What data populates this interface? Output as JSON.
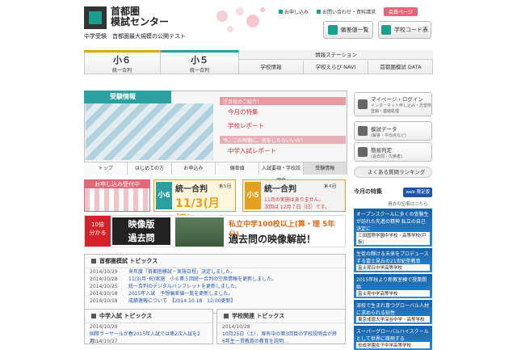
{
  "header": {
    "logo_line1": "首都圏",
    "logo_line2": "模試センター",
    "tagline": "中学受験　首都圏最大規模の公開テスト",
    "links": [
      "お申し込み",
      "お問い合わせ・資料請求"
    ],
    "member": "会員ページ",
    "btn_score": "偏差値一覧",
    "btn_school_code": "学校コード表"
  },
  "nav": {
    "grade6": {
      "label": "小６",
      "sub": "統一合判"
    },
    "grade5": {
      "label": "小５",
      "sub": "統一合判"
    },
    "info_title": "情報ステーション",
    "info_links": [
      "学校情報",
      "学校えらび NAVI",
      "首都圏模試 DATA"
    ]
  },
  "juken": {
    "title": "受験情報",
    "promo_head1": "注目校のご紹介！",
    "promo_links1": [
      "今月の特集",
      "学校レポート"
    ],
    "promo_head2": "今、この時期に、何をしたらいいの？",
    "promo_links2": [
      "中学入試レポート"
    ],
    "tabs": [
      "トップ",
      "はじめての方",
      "お申込み",
      "偏差値",
      "入試要項・学校説明会",
      "受験情報"
    ]
  },
  "banners": {
    "apply": "お申し込み受付中",
    "g6_badge": "小6",
    "g6_title": "統一合判",
    "g6_round": "第５回",
    "g6_date": "11/3(月祝)",
    "g5_badge": "小5",
    "g5_title": "統一合判",
    "g5_round": "第４回",
    "g5_note1": "11月の実施はありません。",
    "g5_note2": "次回は 12月７日（日）です。",
    "video_badge1": "10倍",
    "video_badge2": "分かる",
    "video_title1": "映像版",
    "video_title2": "過去問",
    "video_text1": "私立中学100校以上(算・理 5年分)",
    "video_text2": "過去問の映像解説！"
  },
  "topics_main": {
    "title": "首都圏模試 トピックス",
    "rows": [
      {
        "date": "2014/10/29",
        "msg": "来年度「首都圏模試・実施日程」決定しました。"
      },
      {
        "date": "2014/10/28",
        "msg": "11/3(月･祝)実施　小６第５回統一合判の空席情報を更新しました。"
      },
      {
        "date": "2014/10/25",
        "msg": "統一合判のデジタルパンフレットを更新しました。"
      },
      {
        "date": "2014/10/18",
        "msg": "2015年入試　予想偏差値一覧を更新しました。"
      },
      {
        "date": "2014/10/18",
        "msg": "成績速報について　【2014.10.18　12:00更新】"
      }
    ]
  },
  "topics_ju": {
    "title": "中学入試 トピックス",
    "rows": [
      {
        "date": "2014/10/29",
        "msg": "国際ラーサールが春2015年入試では第2次入試を2月…"
      },
      {
        "date": "2014/10/27",
        "msg": ""
      }
    ]
  },
  "topics_sc": {
    "title": "学校関連 トピックス",
    "rows": [
      {
        "date": "2014/10/28",
        "msg": "10月25日（土）、扉有中の第3回目の学校説明会が終"
      },
      {
        "date": "",
        "msg": "6年生一貫教育の教育を説明…"
      }
    ]
  },
  "right": {
    "mypage": "マイページ・ログイン",
    "mypage_sub": "インターネット申し込み・志望校登録・連絡処理",
    "data": "模試データ",
    "data_sub": "(解答・平均点など)",
    "kan": "簡易判定",
    "kan_sub": "(過去問・欠席者)",
    "faq": "よくある質問ランキング",
    "today": "今月の特集",
    "web": "web 限定版",
    "past": "過去の記事はこちら"
  },
  "ads": [
    {
      "t": "オープンスクールに多くの受験生が訪れた先進の精神 私立の自己決定に",
      "n": "三田国際学園中学校・高等学校(戸板)"
    },
    {
      "t": "生徒の輝ける未来をプロデュースする富士見丘の21世紀型教育",
      "n": "富士見丘中学高等学校"
    },
    {
      "t": "2015年秋より新教室棟で授業開始",
      "n": "富士見中学高等学校"
    },
    {
      "t": "深校で生まれ育つグローバル人材に求められる知性",
      "n": "東京成徳大学深谷中学・高等学校"
    },
    {
      "t": "スーパーグローバルハイスクールとして世界に雄飛する",
      "n": "佼成学園女子中学高等学校"
    }
  ]
}
